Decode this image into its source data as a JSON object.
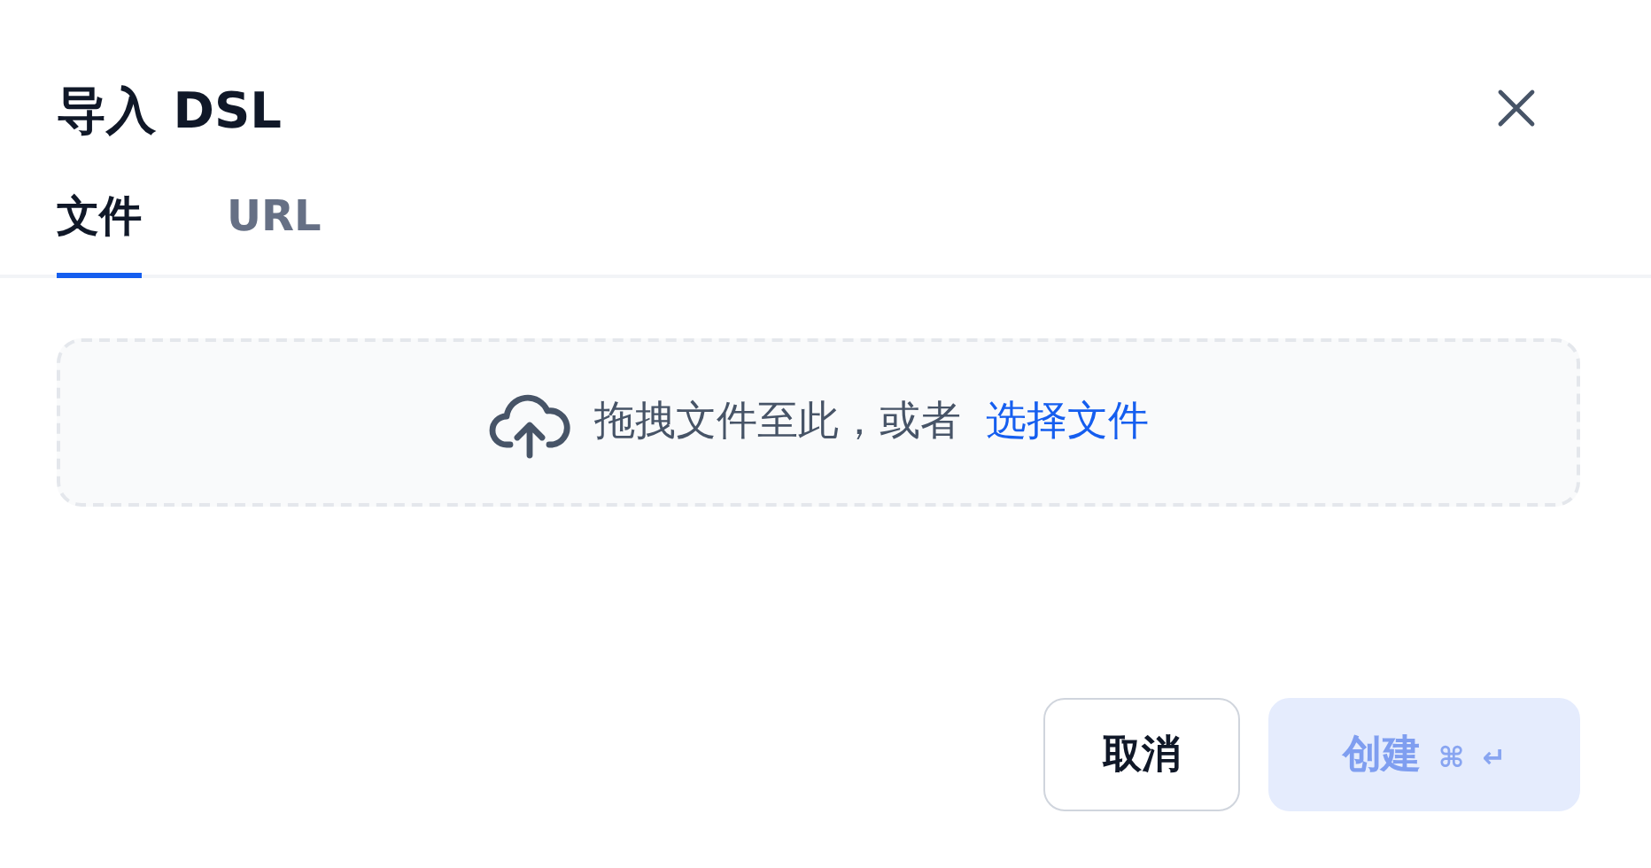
{
  "dialog": {
    "title": "导入 DSL"
  },
  "tabs": [
    {
      "label": "文件",
      "selected": true
    },
    {
      "label": "URL",
      "selected": false
    }
  ],
  "upload": {
    "prompt": "拖拽文件至此，或者",
    "link": "选择文件"
  },
  "buttons": [
    {
      "kind": "secondary",
      "label": "取消",
      "disabled": false
    },
    {
      "kind": "primary",
      "label": "创建",
      "disabled": true,
      "keys": [
        "⌘",
        "↵"
      ]
    }
  ]
}
